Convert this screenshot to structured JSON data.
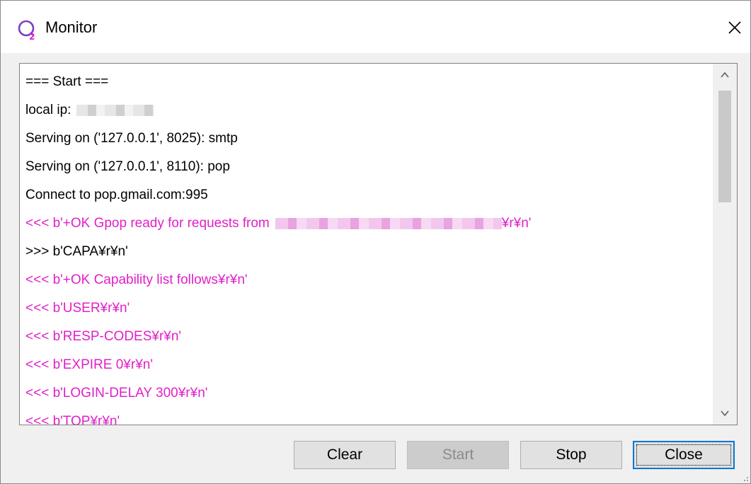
{
  "window": {
    "title": "Monitor",
    "icon": "q2-app-icon",
    "close_icon": "close-icon"
  },
  "log": {
    "lines": [
      {
        "text": "=== Start ===",
        "color": "#000000"
      },
      {
        "text": "local ip:",
        "color": "#000000",
        "redacted": true
      },
      {
        "text": "Serving on ('127.0.0.1', 8025): smtp",
        "color": "#000000"
      },
      {
        "text": "Serving on ('127.0.0.1', 8110): pop",
        "color": "#000000"
      },
      {
        "text": "Connect to pop.gmail.com:995",
        "color": "#000000"
      },
      {
        "text": "<<< b'+OK Gpop ready for requests from",
        "suffix": "¥r¥n'",
        "color": "#e020c8",
        "redacted": true
      },
      {
        "text": ">>> b'CAPA¥r¥n'",
        "color": "#000000"
      },
      {
        "text": "<<< b'+OK Capability list follows¥r¥n'",
        "color": "#e020c8"
      },
      {
        "text": "<<< b'USER¥r¥n'",
        "color": "#e020c8"
      },
      {
        "text": "<<< b'RESP-CODES¥r¥n'",
        "color": "#e020c8"
      },
      {
        "text": "<<< b'EXPIRE 0¥r¥n'",
        "color": "#e020c8"
      },
      {
        "text": "<<< b'LOGIN-DELAY 300¥r¥n'",
        "color": "#e020c8"
      },
      {
        "text": "<<< b'TOP¥r¥n'",
        "color": "#e020c8"
      }
    ]
  },
  "buttons": {
    "clear": "Clear",
    "start": "Start",
    "stop": "Stop",
    "close": "Close"
  },
  "colors": {
    "received": "#e020c8",
    "sent": "#000000",
    "focus_border": "#0078d7"
  }
}
